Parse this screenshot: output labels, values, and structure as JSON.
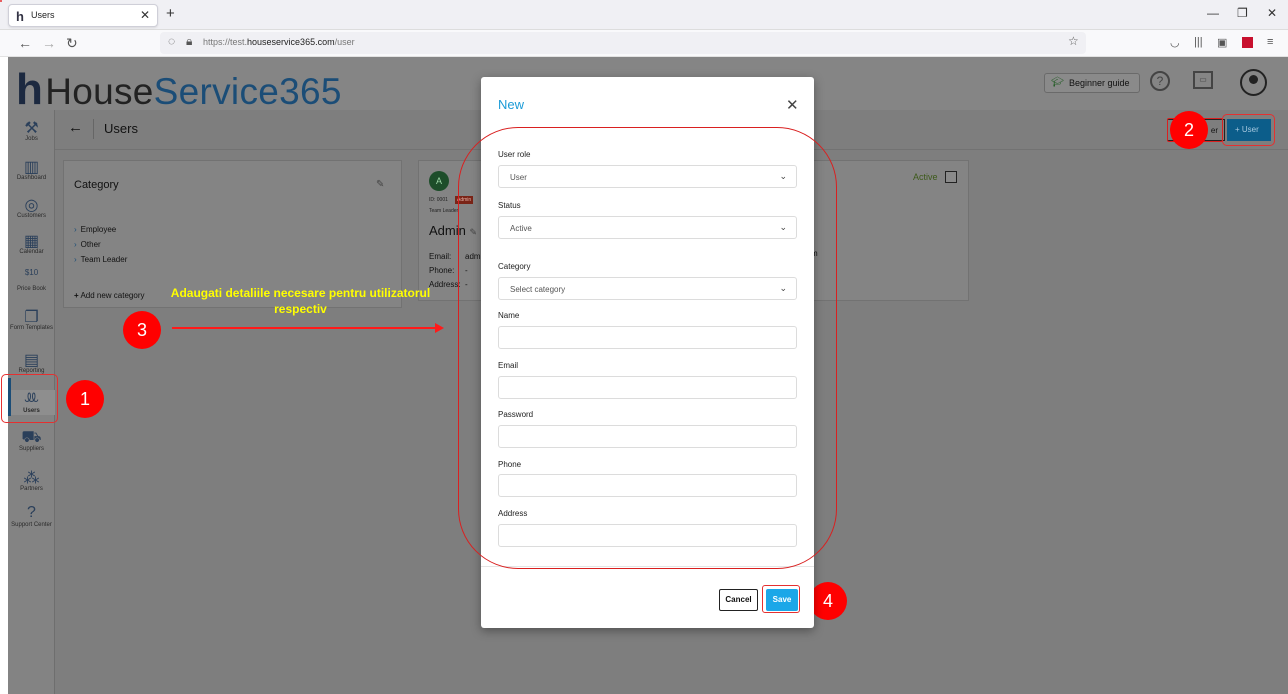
{
  "browser": {
    "tab_label": "Users",
    "tab_favicon": "h",
    "url_prefix": "https://test.",
    "url_domain": "houseservice365.com",
    "url_path": "/user"
  },
  "app": {
    "logo_h": "h",
    "logo_house": "House",
    "logo_service": "Service365",
    "beginner_guide": "Beginner guide",
    "page_title": "Users",
    "btn_ghost": "er",
    "btn_user": "+ User"
  },
  "sidebar": [
    {
      "label": "Jobs",
      "icon": "tools-icon",
      "glyph": "⚒"
    },
    {
      "label": "Dashboard",
      "icon": "chart-icon",
      "glyph": "▥"
    },
    {
      "label": "Customers",
      "icon": "customers-icon",
      "glyph": "◎"
    },
    {
      "label": "Calendar",
      "icon": "calendar-icon",
      "glyph": "▦"
    },
    {
      "label": "Price Book",
      "icon": "pricebook-icon",
      "glyph": "$10"
    },
    {
      "label": "Form Templates",
      "icon": "form-icon",
      "glyph": "❐"
    },
    {
      "label": "Reporting",
      "icon": "reporting-icon",
      "glyph": "▤"
    },
    {
      "label": "Users",
      "icon": "users-icon",
      "glyph": "ꔛ"
    },
    {
      "label": "Suppliers",
      "icon": "truck-icon",
      "glyph": "⛟"
    },
    {
      "label": "Partners",
      "icon": "partners-icon",
      "glyph": "⁂"
    },
    {
      "label": "Support Center",
      "icon": "support-icon",
      "glyph": "?"
    }
  ],
  "category_card": {
    "title": "Category",
    "items": [
      "Employee",
      "Other",
      "Team Leader"
    ],
    "add_label": "Add new category"
  },
  "user_card": {
    "initial": "A",
    "id": "ID: 0001",
    "badge": "Admin",
    "role": "Team Leader",
    "name": "Admin",
    "email_label": "Email:",
    "email_value": "adm",
    "phone_label": "Phone:",
    "phone_value": "-",
    "address_label": "Address:",
    "address_value": "-",
    "email_tail": "m",
    "status": "Active"
  },
  "modal": {
    "title": "New",
    "fields": {
      "user_role": {
        "label": "User role",
        "value": "User"
      },
      "status": {
        "label": "Status",
        "value": "Active"
      },
      "category": {
        "label": "Category",
        "value": "Select category"
      },
      "name": {
        "label": "Name",
        "value": ""
      },
      "email": {
        "label": "Email",
        "value": ""
      },
      "password": {
        "label": "Password",
        "value": ""
      },
      "phone": {
        "label": "Phone",
        "value": ""
      },
      "address": {
        "label": "Address",
        "value": ""
      }
    },
    "cancel": "Cancel",
    "save": "Save"
  },
  "annotations": {
    "n1": "1",
    "n2": "2",
    "n3": "3",
    "n4": "4",
    "text": "Adaugati detaliile necesare pentru utilizatorul respectiv"
  },
  "colors": {
    "accent": "#1ba7e8",
    "annotation_red": "#ff0000",
    "annotation_text": "#ffff00"
  }
}
